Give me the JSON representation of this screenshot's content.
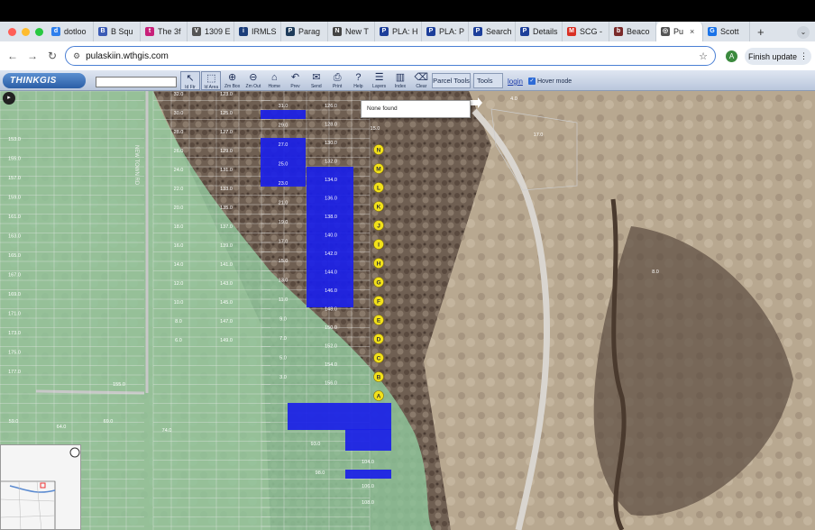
{
  "browser": {
    "tabs": [
      {
        "label": "dotloo",
        "color": "#2f80ed",
        "glyph": "d"
      },
      {
        "label": "B Squ",
        "color": "#3b5bb5",
        "glyph": "B"
      },
      {
        "label": "The 3f",
        "color": "#c8217a",
        "glyph": "t"
      },
      {
        "label": "1309 E",
        "color": "#555555",
        "glyph": "V"
      },
      {
        "label": "IRMLS",
        "color": "#1c3e7a",
        "glyph": "i"
      },
      {
        "label": "Parag",
        "color": "#1e3b5a",
        "glyph": "P"
      },
      {
        "label": "New T",
        "color": "#444444",
        "glyph": "N"
      },
      {
        "label": "PLA: H",
        "color": "#1d3f9a",
        "glyph": "P"
      },
      {
        "label": "PLA: P",
        "color": "#1d3f9a",
        "glyph": "P"
      },
      {
        "label": "Search",
        "color": "#1d3f9a",
        "glyph": "P"
      },
      {
        "label": "Details",
        "color": "#1d3f9a",
        "glyph": "P"
      },
      {
        "label": "SCG -",
        "color": "#d93025",
        "glyph": "M"
      },
      {
        "label": "Beaco",
        "color": "#7a2a2a",
        "glyph": "b"
      },
      {
        "label": "Pu",
        "color": "#555555",
        "glyph": "◎",
        "active": true
      },
      {
        "label": "Scott",
        "color": "#1a73e8",
        "glyph": "G"
      }
    ],
    "tab_close": "×",
    "new_tab": "+",
    "url": "pulaskiin.wthgis.com",
    "avatar_letter": "A",
    "update_label": "Finish update"
  },
  "toolbar": {
    "logo": "THINKGIS",
    "tools": [
      {
        "label": "Id Ftr",
        "icon": "↖"
      },
      {
        "label": "Id Area",
        "icon": "⬚"
      },
      {
        "label": "Zm Box",
        "icon": "⊕"
      },
      {
        "label": "Zm Out",
        "icon": "⊖"
      },
      {
        "label": "Home",
        "icon": "⌂"
      },
      {
        "label": "Prev",
        "icon": "↶"
      },
      {
        "label": "Send",
        "icon": "✉"
      },
      {
        "label": "Print",
        "icon": "⎙"
      },
      {
        "label": "Help",
        "icon": "?"
      },
      {
        "label": "Layers",
        "icon": "☰"
      },
      {
        "label": "Index",
        "icon": "▥"
      },
      {
        "label": "Clear",
        "icon": "⌫"
      }
    ],
    "parcel_tools": "Parcel Tools",
    "tools_menu": "Tools",
    "login": "login",
    "hover_mode": "Hover mode"
  },
  "popup": {
    "text": "None found"
  },
  "map": {
    "road_label": "NEW TOWN RD",
    "lot_numbers_left": [
      "153.0",
      "155.0",
      "157.0",
      "159.0",
      "161.0",
      "163.0",
      "165.0",
      "167.0",
      "169.0",
      "171.0",
      "173.0",
      "175.0",
      "177.0"
    ],
    "lot_numbers_mid": [
      "123.0",
      "125.0",
      "127.0",
      "129.0",
      "131.0",
      "133.0",
      "135.0",
      "137.0",
      "139.0",
      "141.0",
      "143.0",
      "145.0",
      "147.0",
      "149.0"
    ],
    "lot_numbers_right": [
      "126.0",
      "128.0",
      "130.0",
      "132.0",
      "134.0",
      "136.0",
      "138.0",
      "140.0",
      "142.0",
      "144.0",
      "146.0",
      "148.0",
      "150.0",
      "152.0",
      "154.0",
      "156.0"
    ],
    "lot_numbers_inner": [
      "31.0",
      "29.0",
      "27.0",
      "25.0",
      "23.0",
      "21.0",
      "19.0",
      "17.0",
      "15.0",
      "13.0",
      "11.0",
      "9.0",
      "7.0",
      "5.0",
      "3.0"
    ],
    "lot_numbers_col2": [
      "32.0",
      "30.0",
      "28.0",
      "26.0",
      "24.0",
      "22.0",
      "20.0",
      "18.0",
      "16.0",
      "14.0",
      "12.0",
      "10.0",
      "8.0",
      "6.0"
    ],
    "block_letters": [
      "N",
      "M",
      "L",
      "K",
      "J",
      "I",
      "H",
      "G",
      "F",
      "E",
      "D",
      "C",
      "B",
      "A"
    ],
    "misc_labels": [
      "4.0",
      "17.0",
      "8.0",
      "15.0",
      "155.0",
      "64.0",
      "69.0",
      "74.0",
      "59.0",
      "93.0",
      "98.0",
      "104.0",
      "106.0",
      "108.0"
    ]
  }
}
